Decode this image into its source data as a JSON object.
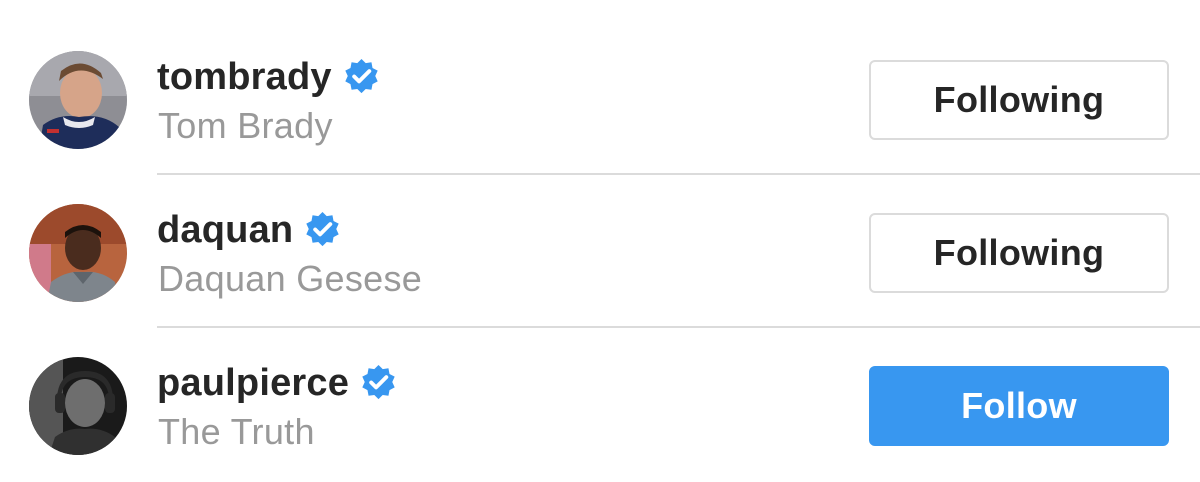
{
  "colors": {
    "verified_badge": "#3897f0",
    "follow_button_bg": "#3897f0",
    "following_button_border": "#dbdbdb",
    "username_text": "#262626",
    "fullname_text": "#999999",
    "divider": "#dbdbdb"
  },
  "users": [
    {
      "username": "tombrady",
      "full_name": "Tom Brady",
      "verified": true,
      "button_label": "Following",
      "button_state": "following",
      "avatar_icon": "profile-photo"
    },
    {
      "username": "daquan",
      "full_name": "Daquan Gesese",
      "verified": true,
      "button_label": "Following",
      "button_state": "following",
      "avatar_icon": "profile-photo"
    },
    {
      "username": "paulpierce",
      "full_name": "The Truth",
      "verified": true,
      "button_label": "Follow",
      "button_state": "follow",
      "avatar_icon": "profile-photo"
    }
  ]
}
